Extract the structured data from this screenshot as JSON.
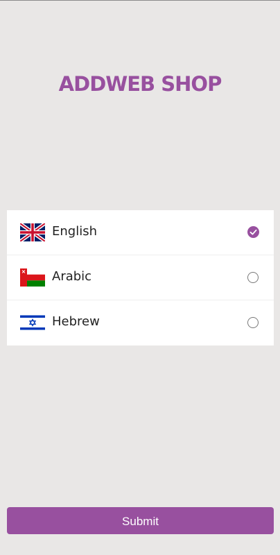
{
  "app": {
    "title": "ADDWEB SHOP"
  },
  "languages": [
    {
      "label": "English",
      "flag": "uk-flag-icon",
      "selected": true
    },
    {
      "label": "Arabic",
      "flag": "oman-flag-icon",
      "selected": false
    },
    {
      "label": "Hebrew",
      "flag": "israel-flag-icon",
      "selected": false
    }
  ],
  "actions": {
    "submit_label": "Submit"
  },
  "colors": {
    "accent": "#98509f",
    "background": "#e9e7e6"
  }
}
